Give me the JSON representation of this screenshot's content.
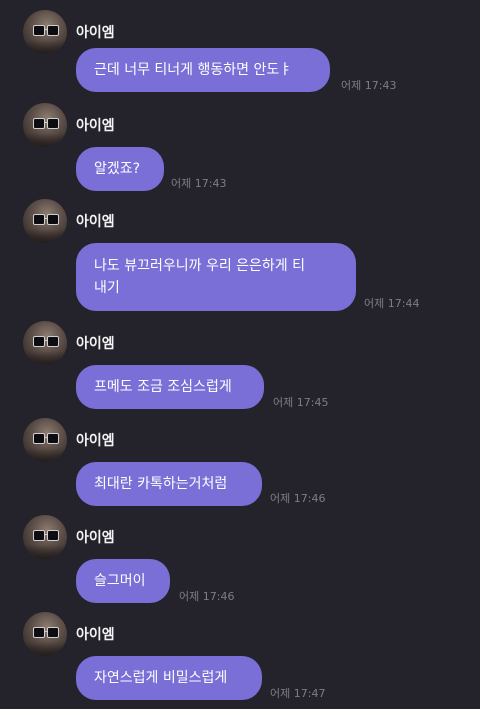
{
  "sender": {
    "name": "아이엠",
    "avatar_icon": "profile-photo-sunglasses"
  },
  "colors": {
    "background": "#24232b",
    "bubble": "#7a6fd6",
    "timestamp": "#7e7d86"
  },
  "messages": [
    {
      "text": "근데 너무 티너게 행동하면 안도ㅑ",
      "time": "어제 17:43"
    },
    {
      "text": "알겠죠?",
      "time": "어제 17:43"
    },
    {
      "line1": "나도 뷰끄러우니까 우리 은은하게 티",
      "line2": "내기",
      "time": "어제 17:44"
    },
    {
      "text": "프메도 조금 조심스럽게",
      "time": "어제 17:45"
    },
    {
      "text": "최대란 카톡하는거처럼",
      "time": "어제 17:46"
    },
    {
      "text": "슬그머이",
      "time": "어제 17:46"
    },
    {
      "text": "자연스럽게 비밀스럽게",
      "time": "어제 17:47"
    }
  ]
}
